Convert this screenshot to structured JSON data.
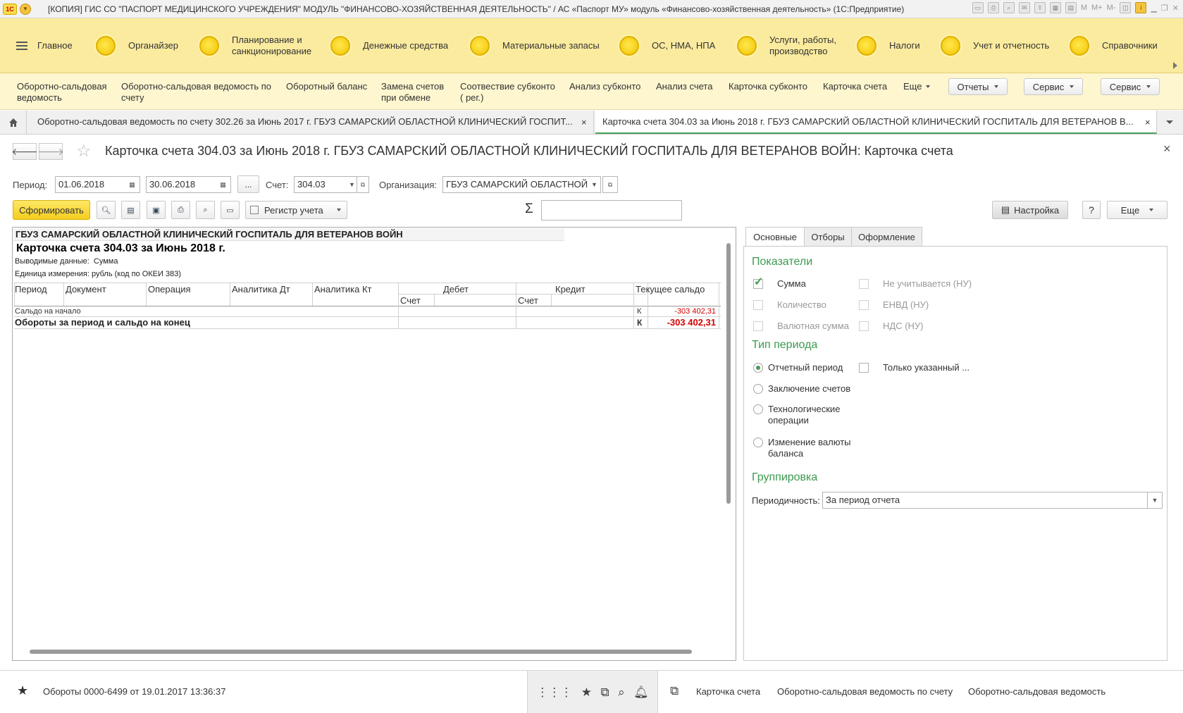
{
  "window": {
    "title": "[КОПИЯ] ГИС СО \"ПАСПОРТ МЕДИЦИНСКОГО УЧРЕЖДЕНИЯ\" МОДУЛЬ \"ФИНАНСОВО-ХОЗЯЙСТВЕННАЯ ДЕЯТЕЛЬНОСТЬ\" / АС «Паспорт МУ» модуль «Финансово-хозяйственная деятельность» (1С:Предприятие)",
    "logo": "1С",
    "memory_buttons": [
      "M",
      "M+",
      "M-"
    ]
  },
  "sections": [
    {
      "label": "Главное"
    },
    {
      "label": "Органайзер"
    },
    {
      "label": "Планирование и санкционирование"
    },
    {
      "label": "Денежные средства"
    },
    {
      "label": "Материальные запасы"
    },
    {
      "label": "ОС, НМА, НПА"
    },
    {
      "label": "Услуги, работы, производство"
    },
    {
      "label": "Налоги"
    },
    {
      "label": "Учет и отчетность"
    },
    {
      "label": "Справочники"
    }
  ],
  "actions": {
    "links": [
      "Оборотно-сальдовая ведомость",
      "Оборотно-сальдовая ведомость по счету",
      "Оборотный баланс",
      "Замена счетов при обмене",
      "Соотвествие субконто ( рег.)",
      "Анализ субконто",
      "Анализ счета",
      "Карточка субконто",
      "Карточка счета",
      "Еще"
    ],
    "buttons": [
      "Отчеты",
      "Сервис",
      "Сервис"
    ]
  },
  "tabs": [
    {
      "label": "Оборотно-сальдовая ведомость по счету 302.26 за Июнь 2017 г. ГБУЗ САМАРСКИЙ ОБЛАСТНОЙ КЛИНИЧЕСКИЙ ГОСПИТ..."
    },
    {
      "label": "Карточка счета 304.03 за Июнь 2018 г. ГБУЗ САМАРСКИЙ ОБЛАСТНОЙ КЛИНИЧЕСКИЙ ГОСПИТАЛЬ ДЛЯ ВЕТЕРАНОВ В..."
    }
  ],
  "form": {
    "title": "Карточка счета 304.03 за Июнь 2018 г. ГБУЗ САМАРСКИЙ ОБЛАСТНОЙ КЛИНИЧЕСКИЙ ГОСПИТАЛЬ ДЛЯ ВЕТЕРАНОВ ВОЙН: Карточка счета",
    "period_label": "Период:",
    "date_from": "01.06.2018",
    "date_to": "30.06.2018",
    "dots": "...",
    "account_label": "Счет:",
    "account": "304.03",
    "org_label": "Организация:",
    "org": "ГБУЗ САМАРСКИЙ ОБЛАСТНОЙ",
    "generate": "Сформировать",
    "register": "Регистр учета",
    "sigma": "Σ",
    "settings": "Настройка",
    "help": "?",
    "more": "Еще",
    "close": "×"
  },
  "report": {
    "org": "ГБУЗ САМАРСКИЙ ОБЛАСТНОЙ КЛИНИЧЕСКИЙ ГОСПИТАЛЬ ДЛЯ ВЕТЕРАНОВ ВОЙН",
    "title": "Карточка счета 304.03 за Июнь 2018 г.",
    "output": "Выводимые данные:  Сумма",
    "unit": "Единица измерения: рубль (код по ОКЕИ 383)",
    "columns": [
      "Период",
      "Документ",
      "Операция",
      "Аналитика Дт",
      "Аналитика Кт",
      "Дебет",
      "Кредит",
      "Текущее сальдо"
    ],
    "subcolumns": [
      "Счет",
      "Счет"
    ],
    "rows": [
      {
        "label": "Сальдо на начало",
        "side": "К",
        "value": "-303 402,31"
      },
      {
        "label": "Обороты за период и сальдо на конец",
        "side": "К",
        "value": "-303 402,31"
      }
    ]
  },
  "settings": {
    "tabs": [
      "Основные",
      "Отборы",
      "Оформление"
    ],
    "indicators_title": "Показатели",
    "indicators": [
      {
        "label": "Сумма",
        "checked": true,
        "disabled": false
      },
      {
        "label": "Количество",
        "checked": false,
        "disabled": true
      },
      {
        "label": "Валютная сумма",
        "checked": false,
        "disabled": true
      },
      {
        "label": "Не учитывается (НУ)",
        "checked": false,
        "disabled": true
      },
      {
        "label": "ЕНВД (НУ)",
        "checked": false,
        "disabled": true
      },
      {
        "label": "НДС (НУ)",
        "checked": false,
        "disabled": true
      }
    ],
    "period_type_title": "Тип периода",
    "period_types": [
      "Отчетный период",
      "Заключение счетов",
      "Технологические операции",
      "Изменение валюты баланса"
    ],
    "only_specified": "Только указанный ...",
    "grouping_title": "Группировка",
    "periodicity_label": "Периодичность:",
    "periodicity": "За период отчета"
  },
  "bottom": {
    "history": "Обороты 0000-6499 от 19.01.2017 13:36:37",
    "links": [
      "Карточка счета",
      "Оборотно-сальдовая ведомость по счету",
      "Оборотно-сальдовая ведомость"
    ]
  }
}
